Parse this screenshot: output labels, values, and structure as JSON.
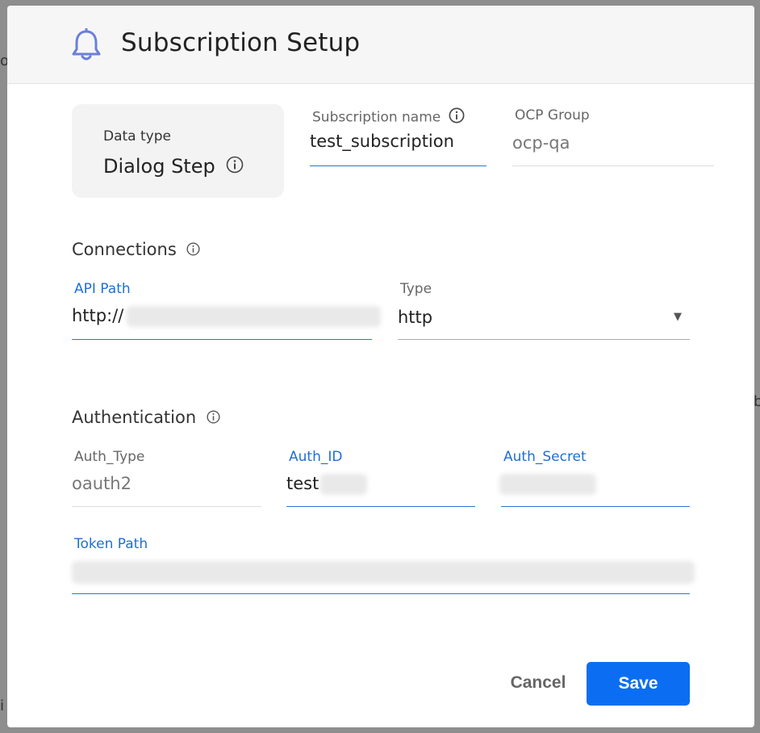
{
  "modal": {
    "title": "Subscription Setup",
    "title_icon": "bell-icon"
  },
  "data_type": {
    "label": "Data type",
    "value": "Dialog Step",
    "icon": "info-icon"
  },
  "subscription_name": {
    "label": "Subscription name",
    "value": "test_subscription",
    "icon": "info-icon"
  },
  "ocp_group": {
    "label": "OCP Group",
    "value": "ocp-qa"
  },
  "connections": {
    "title": "Connections",
    "icon": "info-icon",
    "api_path": {
      "label": "API Path",
      "value": "http://"
    },
    "type": {
      "label": "Type",
      "value": "http",
      "caret": "▼"
    }
  },
  "authentication": {
    "title": "Authentication",
    "icon": "info-icon",
    "auth_type": {
      "label": "Auth_Type",
      "value": "oauth2"
    },
    "auth_id": {
      "label": "Auth_ID",
      "value": "test"
    },
    "auth_secret": {
      "label": "Auth_Secret"
    },
    "token_path": {
      "label": "Token Path"
    }
  },
  "footer": {
    "cancel_label": "Cancel",
    "save_label": "Save"
  },
  "colors": {
    "accent": "#0b6ef2",
    "focused_label": "#1f6fd6",
    "bell": "#6b7fd8"
  }
}
